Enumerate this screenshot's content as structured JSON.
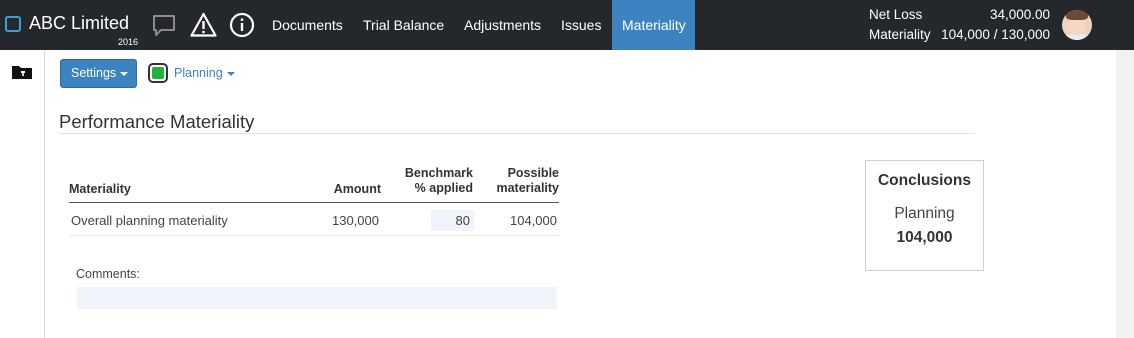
{
  "header": {
    "brand": "ABC Limited",
    "year": "2016",
    "icons": [
      "chat-icon",
      "warning-icon",
      "info-icon"
    ],
    "nav": [
      "Documents",
      "Trial Balance",
      "Adjustments",
      "Issues",
      "Materiality"
    ],
    "active_nav": "Materiality",
    "summary": {
      "net_loss_label": "Net Loss",
      "net_loss_value": "34,000.00",
      "materiality_label": "Materiality",
      "materiality_value": "104,000 / 130,000"
    },
    "colors": {
      "bar": "#24282c",
      "active": "#3d83bf",
      "brand_box": "#3aa0d8"
    }
  },
  "toolbar": {
    "settings_label": "Settings",
    "status_color": "#23b33c",
    "planning_label": "Planning"
  },
  "section": {
    "title": "Performance Materiality"
  },
  "table": {
    "headers": {
      "materiality": "Materiality",
      "amount": "Amount",
      "benchmark_1": "Benchmark",
      "benchmark_2": "% applied",
      "possible_1": "Possible",
      "possible_2": "materiality"
    },
    "rows": [
      {
        "materiality": "Overall planning materiality",
        "amount": "130,000",
        "benchmark": "80",
        "possible": "104,000"
      }
    ]
  },
  "comments": {
    "label": "Comments:",
    "value": ""
  },
  "conclusions": {
    "title": "Conclusions",
    "subtitle": "Planning",
    "value": "104,000"
  }
}
